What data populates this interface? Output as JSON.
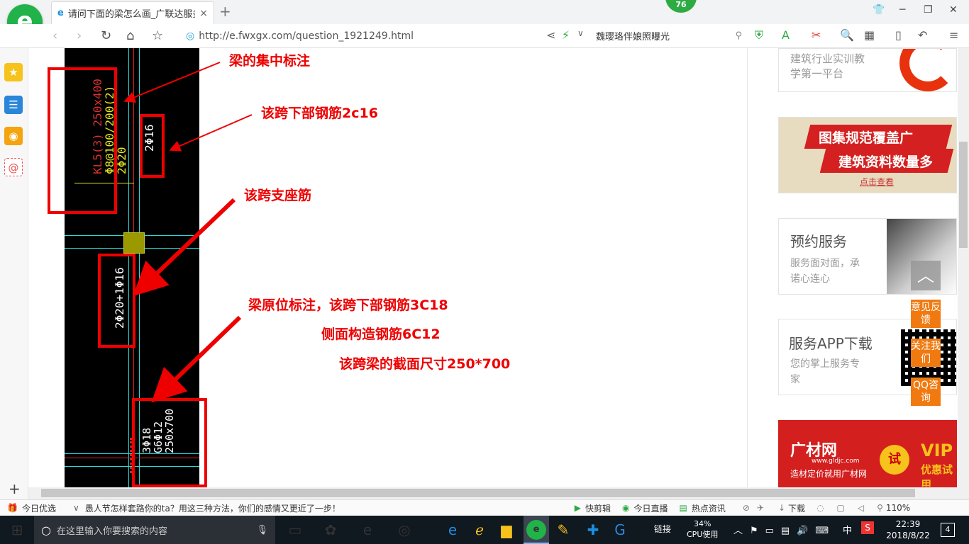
{
  "browser": {
    "tab_title": "请问下面的梁怎么画_广联达服务",
    "tab_close": "×",
    "new_tab": "+",
    "badge": "76",
    "url": "http://e.fwxgx.com/question_1921249.html",
    "search_text": "魏璎珞伴娘照曝光"
  },
  "cad": {
    "beam_label_1": "KL5(3) 250x400",
    "beam_label_2": "Φ8@100/200(2)",
    "beam_label_3": "2Φ20",
    "bottom_bar": "2Φ16",
    "support_bar": "2Φ20+1Φ16",
    "orig_label_1": "3Φ18",
    "orig_label_2": "G6Φ12",
    "orig_label_3": "250x700"
  },
  "annotations": {
    "centralized": "梁的集中标注",
    "bottom": "该跨下部钢筋2c16",
    "support": "该跨支座筋",
    "original": "梁原位标注，该跨下部钢筋3C18",
    "side": "侧面构造钢筋6C12",
    "section": "该跨梁的截面尺寸250*700"
  },
  "ads": {
    "ad1_line1": "建筑行业实训教",
    "ad1_line2": "学第一平台",
    "ad2_line1": "图集规范覆盖广",
    "ad2_line2": "建筑资料数量多",
    "ad2_btn": "点击查看",
    "ad3_title": "预约服务",
    "ad3_line1": "服务面对面，承",
    "ad3_line2": "诺心连心",
    "ad4_title": "服务APP下载",
    "ad4_line1": "您的掌上服务专",
    "ad4_line2": "家",
    "ad5_brand": "广材网",
    "ad5_site": "www.gldjc.com",
    "ad5_slogan": "造材定价就用广材网",
    "ad5_try": "试",
    "ad5_vip": "VIP",
    "ad5_vip_sub": "优惠试用"
  },
  "float": {
    "top": "︿",
    "feedback": "意见反馈",
    "follow": "关注我们",
    "qq": "QQ咨询"
  },
  "statusbar": {
    "daily": "今日优选",
    "news": "愚人节怎样套路你的ta？用这三种方法，你们的感情又更近了一步！",
    "kuaijian": "快剪辑",
    "live": "今日直播",
    "hot": "热点资讯",
    "download": "下载",
    "zoom": "110%"
  },
  "taskbar": {
    "search_placeholder": "在这里输入你要搜索的内容",
    "link": "链接",
    "cpu_pct": "34%",
    "cpu_label": "CPU使用",
    "ime": "中",
    "time": "22:39",
    "date": "2018/8/22",
    "notif": "4"
  },
  "colors": {
    "annotation": "#e00000",
    "accent_green": "#21b24a",
    "float_orange": "#f07a10"
  }
}
